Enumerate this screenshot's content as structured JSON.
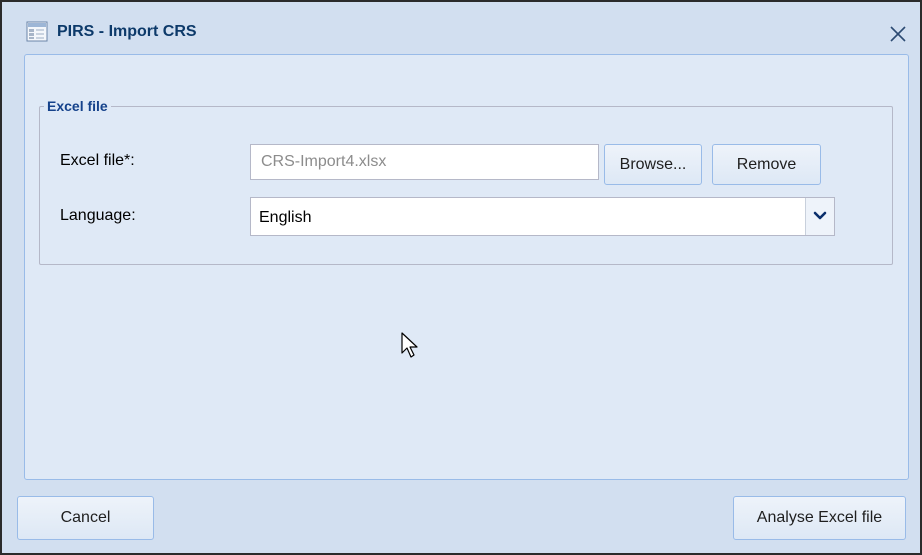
{
  "dialog": {
    "title": "PIRS - Import CRS",
    "icons": {
      "app": "app-window-icon",
      "close": "close-icon"
    }
  },
  "fieldset": {
    "legend": "Excel file",
    "excel_file": {
      "label": "Excel file*:",
      "value": "CRS-Import4.xlsx"
    },
    "browse_label": "Browse...",
    "remove_label": "Remove",
    "language": {
      "label": "Language:",
      "selected": "English",
      "trigger_icon": "chevron-down-icon"
    }
  },
  "footer": {
    "cancel_label": "Cancel",
    "analyse_label": "Analyse Excel file"
  },
  "colors": {
    "title_text": "#0d3a6a",
    "legend_text": "#15428b",
    "window_bg": "#d2dff0",
    "panel_bg": "#dfe9f6",
    "panel_border": "#99bbe8",
    "chevron": "#0a2e6b"
  }
}
